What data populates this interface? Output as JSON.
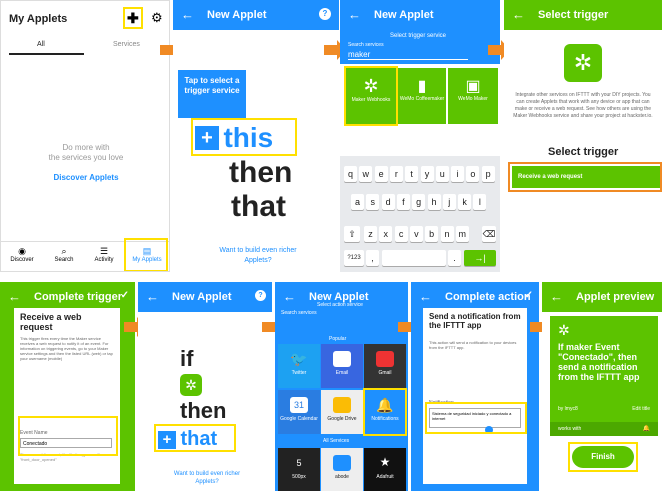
{
  "p1": {
    "title": "My Applets",
    "tab_all": "All",
    "tab_services": "Services",
    "empty1": "Do more with",
    "empty2": "the services you love",
    "discover_link": "Discover Applets",
    "nav": [
      "Discover",
      "Search",
      "Activity",
      "My Applets"
    ]
  },
  "p2": {
    "title": "New Applet",
    "tooltip": "Tap to select a trigger service",
    "word_this": "this",
    "word_then": "then",
    "word_that": "that",
    "footer": "Want to build even richer Applets?"
  },
  "p3": {
    "title": "New Applet",
    "subtitle": "Select trigger service",
    "search_label": "Search services",
    "search_value": "maker",
    "services": [
      "Maker Webhooks",
      "WeMo Coffeemaker",
      "WeMo Maker"
    ],
    "keys_row1": [
      "q",
      "w",
      "e",
      "r",
      "t",
      "y",
      "u",
      "i",
      "o",
      "p"
    ],
    "keys_row2": [
      "a",
      "s",
      "d",
      "f",
      "g",
      "h",
      "j",
      "k",
      "l"
    ],
    "keys_row3": [
      "z",
      "x",
      "c",
      "v",
      "b",
      "n",
      "m"
    ],
    "key_num": "?123",
    "key_comma": ",",
    "key_dot": "."
  },
  "p4": {
    "title": "Select trigger",
    "desc": "Integrate other services on IFTTT with your DIY projects. You can create Applets that work with any device or app that can make or receive a web request. See how others are using the Maker Webhooks service and share your project at hackster.io.",
    "heading": "Select trigger",
    "trigger": "Receive a web request"
  },
  "p5": {
    "title": "Complete trigger",
    "heading": "Receive a web request",
    "desc": "This trigger fires every time the Maker service receives a web request to notify it of an event. For information on triggering events, go to your Maker service settings and then the listed URL (web) or tap your username (mobile)",
    "field_label": "Event Name",
    "field_value": "Conectado",
    "hint": "The name of the event, like \"button_pressed\" or \"front_door_opened\""
  },
  "p6": {
    "title": "New Applet",
    "word_if": "if",
    "word_then": "then",
    "word_that": "that",
    "footer": "Want to build even richer Applets?"
  },
  "p7": {
    "title": "New Applet",
    "subtitle": "Select action service",
    "search_label": "Search services",
    "popular": "Popular",
    "all_services": "All Services",
    "tiles": [
      "Twitter",
      "Email",
      "Gmail",
      "Google Calendar",
      "Google Drive",
      "Notifications",
      "500px",
      "abode",
      "Adafruit"
    ]
  },
  "p8": {
    "title": "Complete action",
    "heading": "Send a notification from the IFTTT app",
    "desc": "This action will send a notification to your devices from the IFTTT app.",
    "field_label": "Notification",
    "field_value": "Sistema de seguridad iniciado y conectado a internet"
  },
  "p9": {
    "title": "Applet preview",
    "summary": "If maker Event \"Conectado\", then send a notification from the IFTTT app",
    "by": "by lmyc8",
    "edit": "Edit title",
    "works_with": "works with",
    "finish": "Finish"
  },
  "colors": {
    "blue": "#1e90ff",
    "green": "#5cc300",
    "orange": "#f08a24",
    "yellow": "#ffe000"
  }
}
